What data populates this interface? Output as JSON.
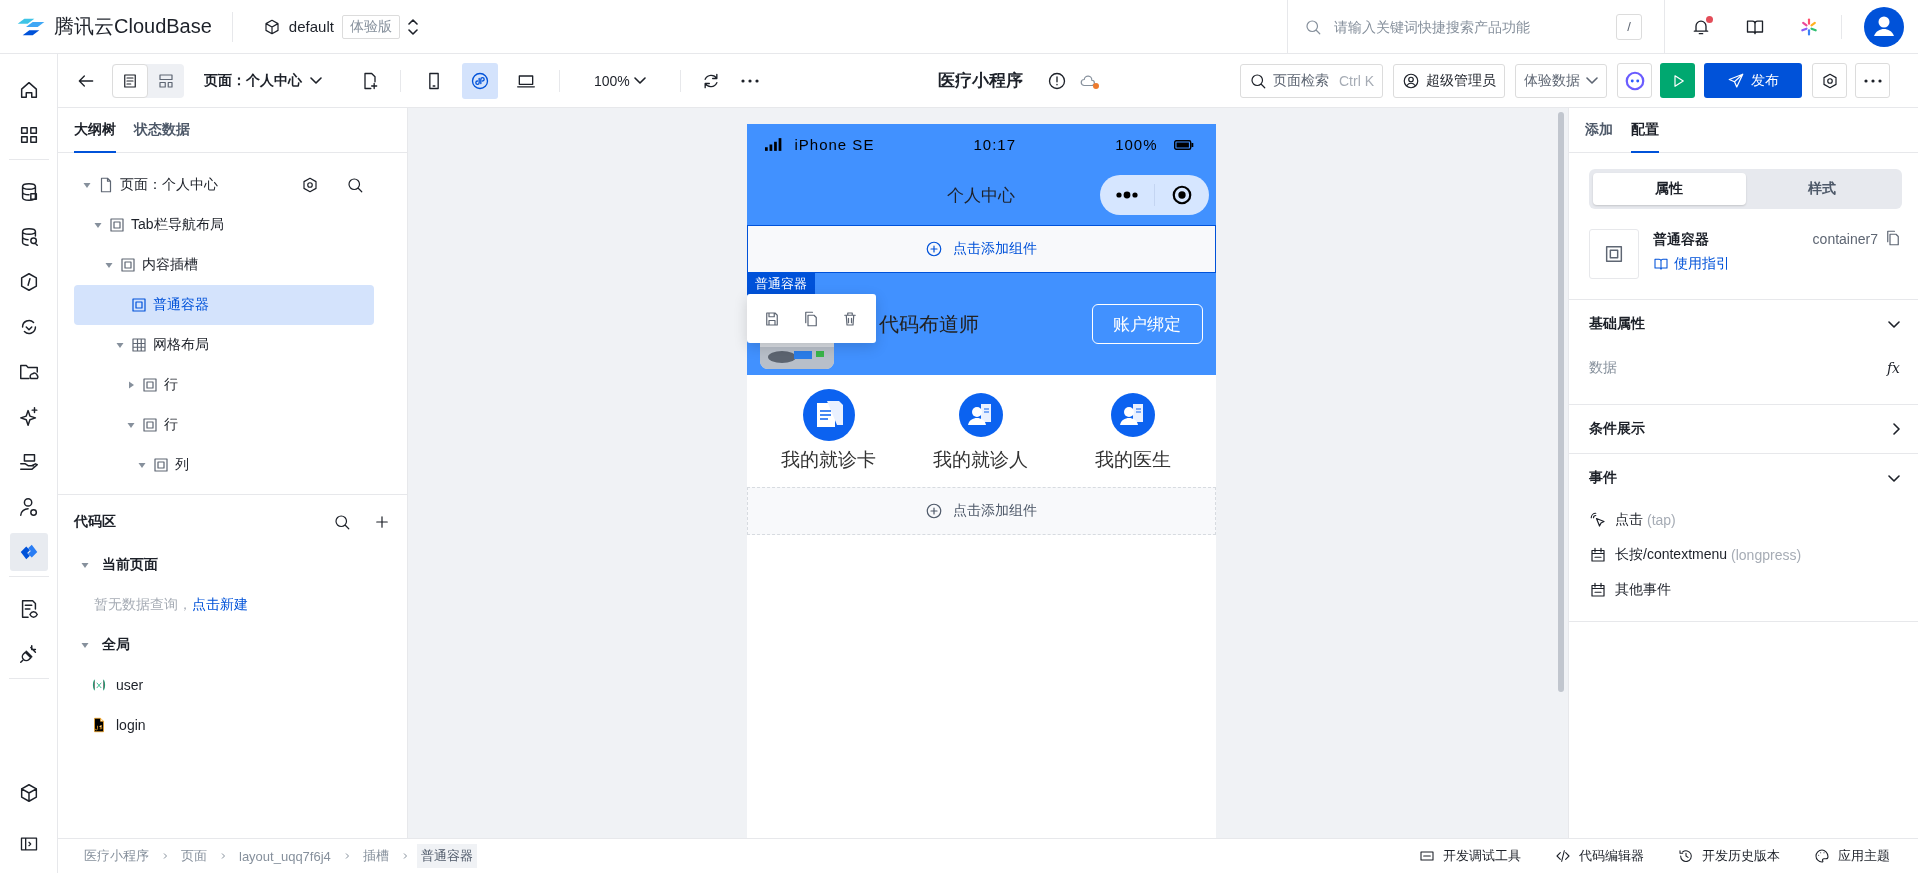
{
  "topbar": {
    "brand": "腾讯云CloudBase",
    "env": "default",
    "env_badge": "体验版",
    "search": {
      "placeholder": "请输入关键词快捷搜索产品功能",
      "shortcut": "/"
    },
    "notifications_unread": true
  },
  "rail": [
    {
      "items": [
        {
          "kind": "home",
          "selected": false
        },
        {
          "kind": "apps",
          "selected": false
        }
      ]
    },
    {
      "items": [
        {
          "kind": "database",
          "selected": false
        },
        {
          "kind": "database-search",
          "selected": false
        },
        {
          "kind": "hexagon",
          "selected": false
        },
        {
          "kind": "sync",
          "selected": false
        },
        {
          "kind": "folder",
          "selected": false
        },
        {
          "kind": "sparkle",
          "selected": false
        },
        {
          "kind": "hand",
          "selected": false
        },
        {
          "kind": "user",
          "selected": false
        },
        {
          "kind": "brand",
          "selected": true
        }
      ]
    },
    {
      "items": [
        {
          "kind": "document",
          "selected": false
        },
        {
          "kind": "plug",
          "selected": false
        }
      ]
    },
    {
      "items": [
        {
          "kind": "cube",
          "selected": false
        }
      ]
    }
  ],
  "toolbar": {
    "view_modes": [
      {
        "kind": "outline",
        "selected": true
      },
      {
        "kind": "layout",
        "selected": false
      }
    ],
    "page_select": "页面：个人中心",
    "devices": [
      {
        "kind": "mobile",
        "selected": false
      },
      {
        "kind": "miniprogram",
        "selected": true
      },
      {
        "kind": "desktop",
        "selected": false
      }
    ],
    "zoom": "100%",
    "app_title": "医疗小程序",
    "unsaved": true,
    "page_search": {
      "label": "页面检索",
      "shortcut": "Ctrl K"
    },
    "role": "超级管理员",
    "data_source": "体验数据",
    "publish": "发布"
  },
  "outline": {
    "tabs": [
      {
        "label": "大纲树",
        "selected": true
      },
      {
        "label": "状态数据",
        "selected": false
      }
    ],
    "tree": [
      {
        "label": "页面：个人中心",
        "kind": "page",
        "expanded": true,
        "selected": false,
        "children": [
          {
            "label": "Tab栏导航布局",
            "kind": "container",
            "expanded": true,
            "selected": false,
            "children": [
              {
                "label": "内容插槽",
                "kind": "container",
                "expanded": true,
                "selected": false,
                "children": [
                  {
                    "label": "普通容器",
                    "kind": "container",
                    "selected": true
                  },
                  {
                    "label": "网格布局",
                    "kind": "grid",
                    "expanded": true,
                    "selected": false,
                    "children": [
                      {
                        "label": "行",
                        "kind": "container",
                        "expanded": false,
                        "selected": false
                      },
                      {
                        "label": "行",
                        "kind": "container",
                        "expanded": true,
                        "selected": false,
                        "children": [
                          {
                            "label": "列",
                            "kind": "container",
                            "expanded": true,
                            "selected": false
                          }
                        ]
                      }
                    ]
                  }
                ]
              }
            ]
          }
        ]
      }
    ]
  },
  "code_area": {
    "title": "代码区",
    "groups": [
      {
        "title": "当前页面",
        "expanded": true,
        "empty_text": "暂无数据查询，",
        "empty_link": "点击新建"
      },
      {
        "title": "全局",
        "expanded": true,
        "items": [
          {
            "label": "user",
            "kind": "variable"
          },
          {
            "label": "login",
            "kind": "script"
          }
        ]
      }
    ]
  },
  "phone": {
    "device": "iPhone SE",
    "time": "10:17",
    "battery": "100%",
    "title": "个人中心",
    "add_slots": [
      {
        "label": "点击添加组件",
        "highlighted": true
      },
      {
        "label": "点击添加组件",
        "highlighted": false
      }
    ],
    "selected_tag": "普通容器",
    "profile": {
      "name": "代码布道师",
      "bind_button": "账户绑定"
    },
    "menu": [
      {
        "label": "我的就诊卡",
        "kind": "cards"
      },
      {
        "label": "我的就诊人",
        "kind": "patient"
      },
      {
        "label": "我的医生",
        "kind": "patient"
      }
    ]
  },
  "inspector": {
    "tabs": [
      {
        "label": "添加",
        "selected": false
      },
      {
        "label": "配置",
        "selected": true
      }
    ],
    "segments": [
      {
        "label": "属性",
        "selected": true
      },
      {
        "label": "样式",
        "selected": false
      }
    ],
    "component": {
      "name": "普通容器",
      "guide": "使用指引",
      "id": "container7"
    },
    "sections": [
      {
        "title": "基础属性",
        "expanded": true,
        "fields": [
          {
            "label": "数据",
            "action": "fx"
          }
        ]
      },
      {
        "title": "条件展示",
        "expanded": false
      },
      {
        "title": "事件",
        "expanded": true,
        "events": [
          {
            "label": "点击",
            "hint": "(tap)",
            "kind": "tap"
          },
          {
            "label": "长按/contextmenu",
            "hint": "(longpress)",
            "kind": "calendar"
          },
          {
            "label": "其他事件",
            "kind": "calendar"
          }
        ]
      }
    ]
  },
  "footer": {
    "breadcrumb": [
      "医疗小程序",
      "页面",
      "layout_uqq7f6j4",
      "插槽",
      "普通容器"
    ],
    "tools": [
      {
        "label": "开发调试工具",
        "kind": "debug"
      },
      {
        "label": "代码编辑器",
        "kind": "code"
      },
      {
        "label": "开发历史版本",
        "kind": "history"
      },
      {
        "label": "应用主题",
        "kind": "theme"
      }
    ]
  }
}
